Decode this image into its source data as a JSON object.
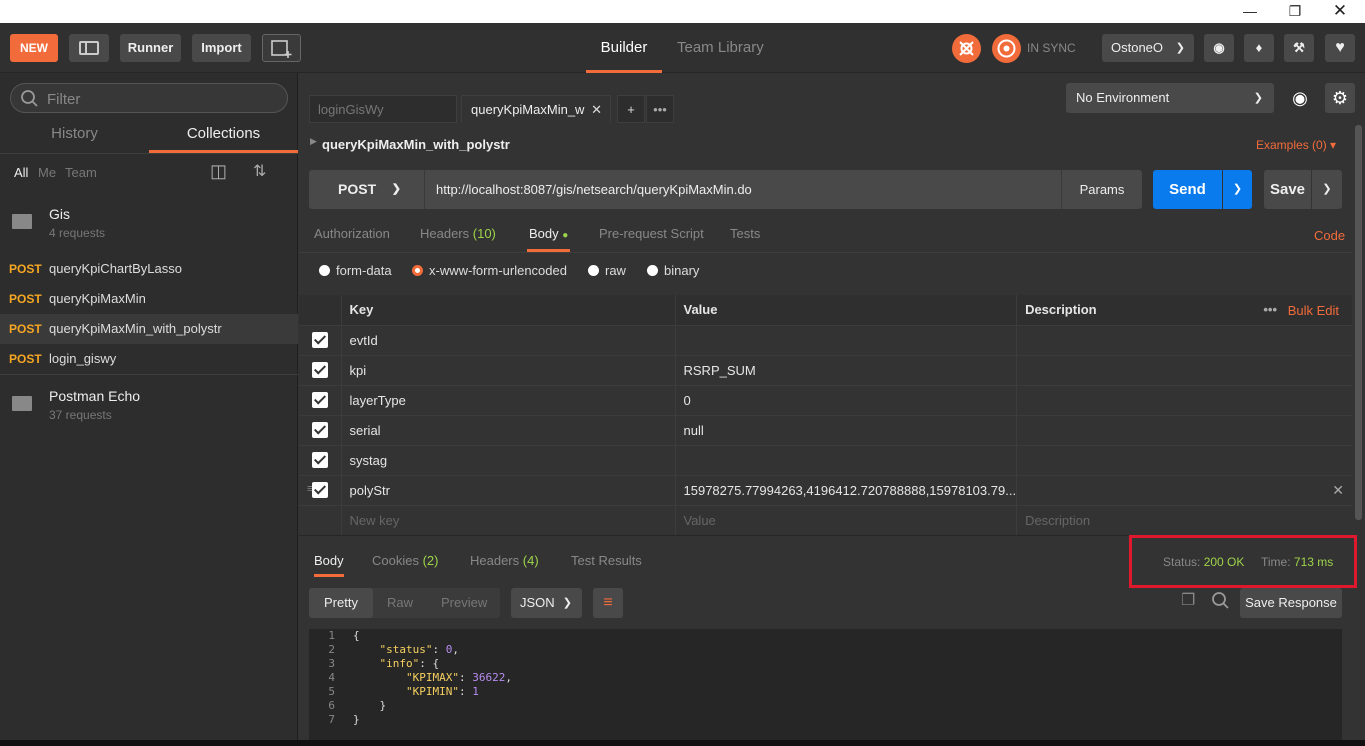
{
  "header": {
    "new_label": "NEW",
    "runner_label": "Runner",
    "import_label": "Import",
    "tab_builder": "Builder",
    "tab_team_library": "Team Library",
    "sync_label": "IN SYNC",
    "user_label": "OstoneO"
  },
  "sidebar": {
    "filter_placeholder": "Filter",
    "tab_history": "History",
    "tab_collections": "Collections",
    "filter_all": "All",
    "filter_me": "Me",
    "filter_team": "Team",
    "collections": [
      {
        "name": "Gis",
        "count": "4 requests"
      },
      {
        "name": "Postman Echo",
        "count": "37 requests"
      }
    ],
    "requests": [
      {
        "method": "POST",
        "name": "queryKpiChartByLasso"
      },
      {
        "method": "POST",
        "name": "queryKpiMaxMin"
      },
      {
        "method": "POST",
        "name": "queryKpiMaxMin_with_polystr"
      },
      {
        "method": "POST",
        "name": "login_giswy"
      }
    ]
  },
  "tabs": {
    "tab1": "loginGisWy",
    "tab2": "queryKpiMaxMin_w"
  },
  "environment": {
    "selected": "No Environment"
  },
  "request": {
    "name": "queryKpiMaxMin_with_polystr",
    "examples": "Examples (0)",
    "method": "POST",
    "url": "http://localhost:8087/gis/netsearch/queryKpiMaxMin.do",
    "params_label": "Params",
    "send_label": "Send",
    "save_label": "Save",
    "code_label": "Code",
    "subtabs": {
      "authorization": "Authorization",
      "headers": "Headers",
      "headers_count": "(10)",
      "body": "Body",
      "prerequest": "Pre-request Script",
      "tests": "Tests"
    },
    "body_modes": {
      "form_data": "form-data",
      "urlencoded": "x-www-form-urlencoded",
      "raw": "raw",
      "binary": "binary"
    },
    "table_headers": {
      "key": "Key",
      "value": "Value",
      "description": "Description",
      "bulk_edit": "Bulk Edit"
    },
    "rows": [
      {
        "key": "evtId",
        "value": ""
      },
      {
        "key": "kpi",
        "value": "RSRP_SUM"
      },
      {
        "key": "layerType",
        "value": "0"
      },
      {
        "key": "serial",
        "value": "null"
      },
      {
        "key": "systag",
        "value": ""
      },
      {
        "key": "polyStr",
        "value": "15978275.77994263,4196412.720788888,15978103.79..."
      }
    ],
    "new_key_placeholder": "New key",
    "new_value_placeholder": "Value",
    "new_desc_placeholder": "Description"
  },
  "response": {
    "tab_body": "Body",
    "tab_cookies": "Cookies",
    "cookies_count": "(2)",
    "tab_headers": "Headers",
    "headers_count": "(4)",
    "tab_tests": "Test Results",
    "status_label": "Status:",
    "status_value": "200 OK",
    "time_label": "Time:",
    "time_value": "713 ms",
    "view_pretty": "Pretty",
    "view_raw": "Raw",
    "view_preview": "Preview",
    "format": "JSON",
    "save_response": "Save Response",
    "lines": [
      "1",
      "2",
      "3",
      "4",
      "5",
      "6",
      "7"
    ]
  },
  "colors": {
    "accent": "#f26b3a",
    "send_blue": "#097bed",
    "status_green": "#9ed44a",
    "highlight_red": "#e0182e"
  }
}
